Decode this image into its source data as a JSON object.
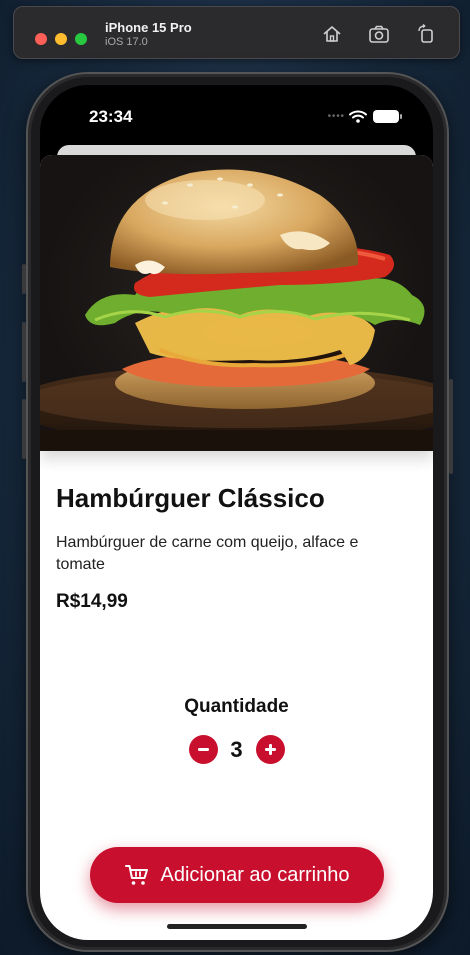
{
  "simulator": {
    "device_name": "iPhone 15 Pro",
    "os_version": "iOS 17.0",
    "toolbar_icons": [
      "home-icon",
      "screenshot-icon",
      "rotate-icon"
    ]
  },
  "status_bar": {
    "time": "23:34",
    "icons": [
      "signal-icon",
      "wifi-icon",
      "battery-icon"
    ]
  },
  "product": {
    "image": "burger-photo",
    "name": "Hambúrguer Clássico",
    "description": "Hambúrguer de carne com queijo, alface e tomate",
    "price": "R$14,99"
  },
  "quantity": {
    "label": "Quantidade",
    "value": "3",
    "decrement_icon": "minus-icon",
    "increment_icon": "plus-icon"
  },
  "cart_button": {
    "label": "Adicionar ao carrinho",
    "icon": "cart-icon"
  },
  "colors": {
    "accent": "#c8102e",
    "background": "#ffffff",
    "text": "#111111"
  }
}
